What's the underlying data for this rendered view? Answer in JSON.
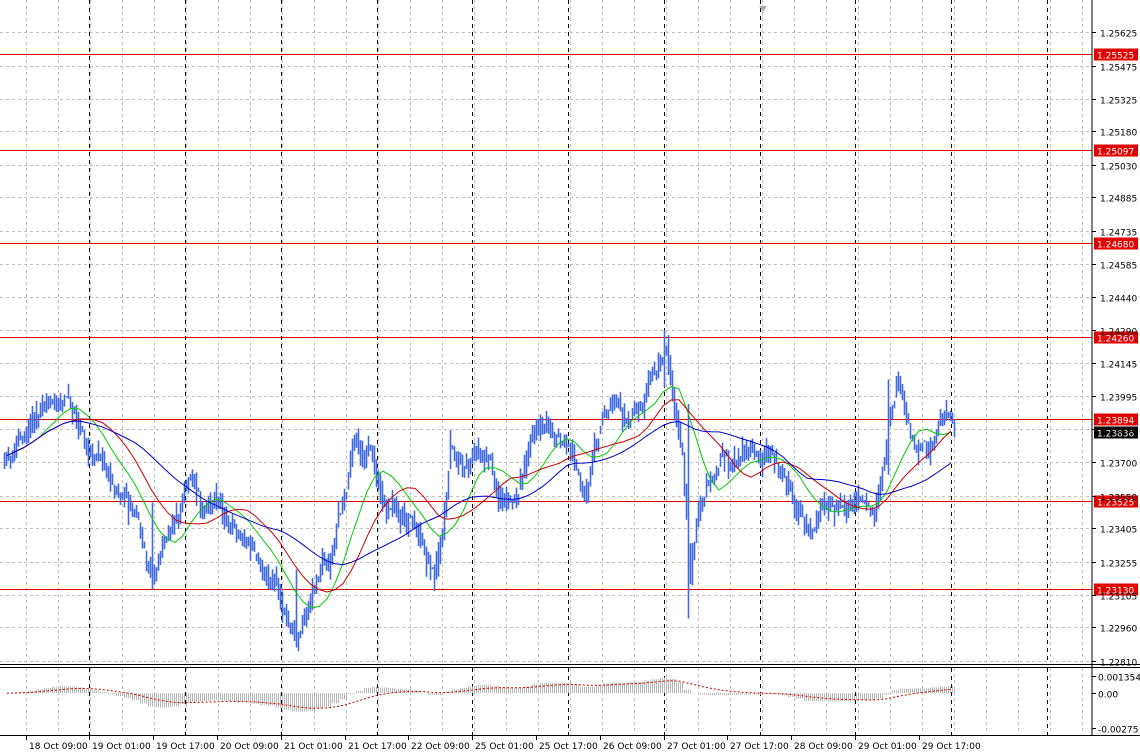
{
  "colors": {
    "background": "#ffffff",
    "grid": "#c0c0c0",
    "candles": "#4169e1",
    "level_lines": "#e00000",
    "ma_fast": "#00cc00",
    "ma_mid": "#cc0000",
    "ma_slow": "#0000cc",
    "osc_bars": "#b8b8b8",
    "osc_signal": "#cc0000",
    "current_price_label": "#000000"
  },
  "chart_data": [
    {
      "type": "candlestick",
      "title": "",
      "y_axis_ticks": [
        "1.25625",
        "1.25475",
        "1.25325",
        "1.25180",
        "1.25030",
        "1.24885",
        "1.24735",
        "1.24585",
        "1.24440",
        "1.24290",
        "1.24145",
        "1.23995",
        "1.23850",
        "1.23700",
        "1.23550",
        "1.23405",
        "1.23255",
        "1.23105",
        "1.22960",
        "1.22810"
      ],
      "ylim": [
        1.2281,
        1.2566
      ],
      "x_axis_ticks": [
        "18 Oct 09:00",
        "19 Oct 01:00",
        "19 Oct 17:00",
        "20 Oct 09:00",
        "21 Oct 01:00",
        "21 Oct 17:00",
        "22 Oct 09:00",
        "25 Oct 01:00",
        "25 Oct 17:00",
        "26 Oct 09:00",
        "27 Oct 01:00",
        "27 Oct 17:00",
        "28 Oct 09:00",
        "29 Oct 01:00",
        "29 Oct 17:00"
      ],
      "grid": true,
      "horizontal_levels": [
        {
          "value": 1.25525,
          "label": "1.25525"
        },
        {
          "value": 1.25097,
          "label": "1.25097"
        },
        {
          "value": 1.2468,
          "label": "1.24680"
        },
        {
          "value": 1.2426,
          "label": "1.24260"
        },
        {
          "value": 1.23894,
          "label": "1.23894"
        },
        {
          "value": 1.23525,
          "label": "1.23525"
        },
        {
          "value": 1.2313,
          "label": "1.23130"
        }
      ],
      "current_price": {
        "value": 1.23836,
        "label": "1.23836"
      },
      "close_path": [
        [
          0,
          1.2373
        ],
        [
          3,
          1.2392
        ],
        [
          6,
          1.2401
        ],
        [
          8,
          1.2391
        ],
        [
          10,
          1.2374
        ],
        [
          12,
          1.2366
        ],
        [
          15,
          1.2352
        ],
        [
          18,
          1.2318
        ],
        [
          20,
          1.2345
        ],
        [
          22,
          1.2358
        ],
        [
          25,
          1.2352
        ],
        [
          27,
          1.2346
        ],
        [
          29,
          1.2336
        ],
        [
          32,
          1.2322
        ],
        [
          34,
          1.2305
        ],
        [
          36,
          1.2292
        ],
        [
          38,
          1.2318
        ],
        [
          40,
          1.2327
        ],
        [
          41,
          1.2348
        ],
        [
          43,
          1.2378
        ],
        [
          45,
          1.2372
        ],
        [
          47,
          1.2352
        ],
        [
          49,
          1.2346
        ],
        [
          51,
          1.2338
        ],
        [
          53,
          1.2322
        ],
        [
          54,
          1.2338
        ],
        [
          55,
          1.2382
        ],
        [
          57,
          1.2368
        ],
        [
          59,
          1.2373
        ],
        [
          61,
          1.2355
        ],
        [
          63,
          1.2352
        ],
        [
          65,
          1.2376
        ],
        [
          66,
          1.2388
        ],
        [
          68,
          1.2385
        ],
        [
          69,
          1.2381
        ],
        [
          70,
          1.2376
        ],
        [
          71,
          1.2367
        ],
        [
          72,
          1.2357
        ],
        [
          74,
          1.2387
        ],
        [
          76,
          1.2392
        ],
        [
          77,
          1.2382
        ],
        [
          78,
          1.2392
        ],
        [
          79,
          1.2392
        ],
        [
          80,
          1.2408
        ],
        [
          81,
          1.2418
        ],
        [
          82,
          1.2424
        ],
        [
          83,
          1.2396
        ],
        [
          84,
          1.2376
        ],
        [
          85,
          1.2321
        ],
        [
          86,
          1.2346
        ],
        [
          88,
          1.2367
        ],
        [
          90,
          1.2372
        ],
        [
          92,
          1.2375
        ],
        [
          94,
          1.2374
        ],
        [
          96,
          1.2367
        ],
        [
          98,
          1.2349
        ],
        [
          100,
          1.2342
        ],
        [
          102,
          1.2347
        ],
        [
          104,
          1.2356
        ],
        [
          106,
          1.2352
        ],
        [
          108,
          1.2344
        ],
        [
          109,
          1.2362
        ],
        [
          110,
          1.2396
        ],
        [
          111,
          1.2404
        ],
        [
          112,
          1.2392
        ],
        [
          113,
          1.2381
        ],
        [
          114,
          1.2384
        ],
        [
          115,
          1.2383
        ],
        [
          116,
          1.2386
        ],
        [
          117,
          1.2386
        ],
        [
          118,
          1.2384
        ]
      ],
      "spikes": [
        {
          "index": 82,
          "low": 1.2405,
          "high": 1.2429
        },
        {
          "index": 85,
          "low": 1.23,
          "high": 1.2396
        },
        {
          "index": 36,
          "low": 1.2287,
          "high": 1.2322
        },
        {
          "index": 18,
          "low": 1.2313,
          "high": 1.2352
        },
        {
          "index": 110,
          "low": 1.2375,
          "high": 1.2407
        }
      ],
      "moving_averages": [
        {
          "color_key": "ma_fast",
          "period": 5
        },
        {
          "color_key": "ma_mid",
          "period": 9
        },
        {
          "color_key": "ma_slow",
          "period": 16
        }
      ]
    },
    {
      "type": "bar",
      "title": "",
      "y_axis_ticks": [
        "0.001354",
        "0.00",
        "-0.00275"
      ],
      "ylim": [
        -0.00275,
        0.001354
      ],
      "values_source": "computed from close_path momentum",
      "signal_line": true,
      "grid": true
    }
  ]
}
